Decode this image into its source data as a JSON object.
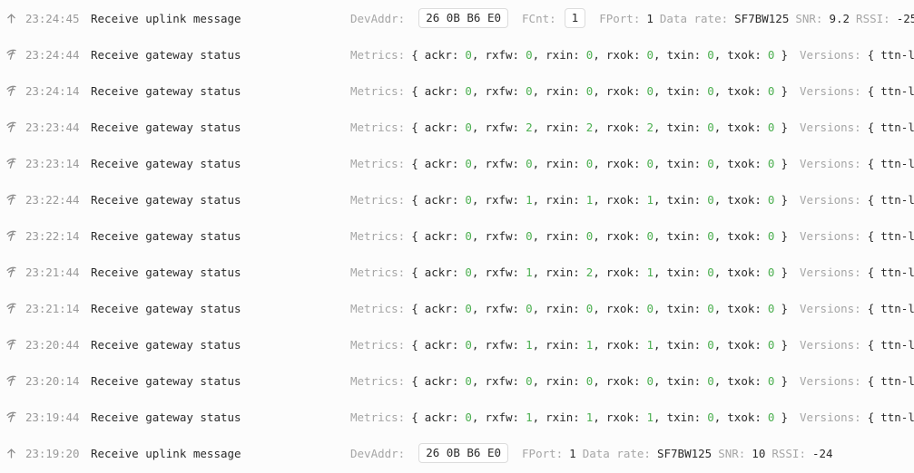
{
  "colors": {
    "background": "#fcfcfc",
    "muted_label": "#a6a6a6",
    "value_text": "#2b2b2b",
    "numeric_green": "#4caf50",
    "time_text": "#9a9a9a",
    "chip_border": "#dcdcdc"
  },
  "labels": {
    "devaddr": "DevAddr:",
    "fcnt": "FCnt:",
    "fport": "FPort:",
    "data_rate": "Data rate:",
    "snr": "SNR:",
    "rssi": "RSSI:",
    "metrics": "Metrics:",
    "versions": "Versions:",
    "ackr": "ackr:",
    "rxfw": "rxfw:",
    "rxin": "rxin:",
    "rxok": "rxok:",
    "txin": "txin:",
    "txok": "txok:",
    "brace_open": "{",
    "brace_close": "}",
    "comma": ",",
    "versions_value": "ttn-lw-ga"
  },
  "events": [
    {
      "icon": "arrow-up-icon",
      "time": "23:24:45",
      "description": "Receive uplink message",
      "type": "uplink",
      "devaddr": "26 0B B6 E0",
      "fcnt": "1",
      "fport": "1",
      "data_rate": "SF7BW125",
      "snr": "9.2",
      "rssi": "-25"
    },
    {
      "icon": "gateway-antenna-icon",
      "time": "23:24:44",
      "description": "Receive gateway status",
      "type": "gateway",
      "metrics": {
        "ackr": "0",
        "rxfw": "0",
        "rxin": "0",
        "rxok": "0",
        "txin": "0",
        "txok": "0"
      }
    },
    {
      "icon": "gateway-antenna-icon",
      "time": "23:24:14",
      "description": "Receive gateway status",
      "type": "gateway",
      "metrics": {
        "ackr": "0",
        "rxfw": "0",
        "rxin": "0",
        "rxok": "0",
        "txin": "0",
        "txok": "0"
      }
    },
    {
      "icon": "gateway-antenna-icon",
      "time": "23:23:44",
      "description": "Receive gateway status",
      "type": "gateway",
      "metrics": {
        "ackr": "0",
        "rxfw": "2",
        "rxin": "2",
        "rxok": "2",
        "txin": "0",
        "txok": "0"
      }
    },
    {
      "icon": "gateway-antenna-icon",
      "time": "23:23:14",
      "description": "Receive gateway status",
      "type": "gateway",
      "metrics": {
        "ackr": "0",
        "rxfw": "0",
        "rxin": "0",
        "rxok": "0",
        "txin": "0",
        "txok": "0"
      }
    },
    {
      "icon": "gateway-antenna-icon",
      "time": "23:22:44",
      "description": "Receive gateway status",
      "type": "gateway",
      "metrics": {
        "ackr": "0",
        "rxfw": "1",
        "rxin": "1",
        "rxok": "1",
        "txin": "0",
        "txok": "0"
      }
    },
    {
      "icon": "gateway-antenna-icon",
      "time": "23:22:14",
      "description": "Receive gateway status",
      "type": "gateway",
      "metrics": {
        "ackr": "0",
        "rxfw": "0",
        "rxin": "0",
        "rxok": "0",
        "txin": "0",
        "txok": "0"
      }
    },
    {
      "icon": "gateway-antenna-icon",
      "time": "23:21:44",
      "description": "Receive gateway status",
      "type": "gateway",
      "metrics": {
        "ackr": "0",
        "rxfw": "1",
        "rxin": "2",
        "rxok": "1",
        "txin": "0",
        "txok": "0"
      }
    },
    {
      "icon": "gateway-antenna-icon",
      "time": "23:21:14",
      "description": "Receive gateway status",
      "type": "gateway",
      "metrics": {
        "ackr": "0",
        "rxfw": "0",
        "rxin": "0",
        "rxok": "0",
        "txin": "0",
        "txok": "0"
      }
    },
    {
      "icon": "gateway-antenna-icon",
      "time": "23:20:44",
      "description": "Receive gateway status",
      "type": "gateway",
      "metrics": {
        "ackr": "0",
        "rxfw": "1",
        "rxin": "1",
        "rxok": "1",
        "txin": "0",
        "txok": "0"
      }
    },
    {
      "icon": "gateway-antenna-icon",
      "time": "23:20:14",
      "description": "Receive gateway status",
      "type": "gateway",
      "metrics": {
        "ackr": "0",
        "rxfw": "0",
        "rxin": "0",
        "rxok": "0",
        "txin": "0",
        "txok": "0"
      }
    },
    {
      "icon": "gateway-antenna-icon",
      "time": "23:19:44",
      "description": "Receive gateway status",
      "type": "gateway",
      "metrics": {
        "ackr": "0",
        "rxfw": "1",
        "rxin": "1",
        "rxok": "1",
        "txin": "0",
        "txok": "0"
      }
    },
    {
      "icon": "arrow-up-icon",
      "time": "23:19:20",
      "description": "Receive uplink message",
      "type": "uplink",
      "devaddr": "26 0B B6 E0",
      "fport": "1",
      "data_rate": "SF7BW125",
      "snr": "10",
      "rssi": "-24"
    }
  ]
}
